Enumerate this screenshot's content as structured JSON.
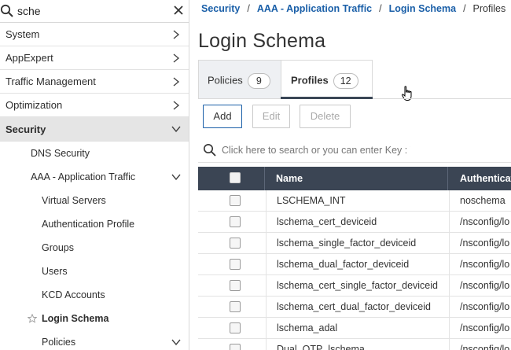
{
  "sidebar": {
    "search": {
      "value": "sche"
    },
    "items": [
      {
        "label": "System"
      },
      {
        "label": "AppExpert"
      },
      {
        "label": "Traffic Management"
      },
      {
        "label": "Optimization"
      },
      {
        "label": "Security"
      }
    ],
    "security_children": [
      {
        "label": "DNS Security"
      },
      {
        "label": "AAA - Application Traffic"
      }
    ],
    "aaa_children": [
      {
        "label": "Virtual Servers"
      },
      {
        "label": "Authentication Profile"
      },
      {
        "label": "Groups"
      },
      {
        "label": "Users"
      },
      {
        "label": "KCD Accounts"
      },
      {
        "label": "Login Schema"
      },
      {
        "label": "Policies"
      }
    ]
  },
  "breadcrumb": {
    "items": [
      "Security",
      "AAA - Application Traffic",
      "Login Schema"
    ],
    "separator": "/",
    "current": "Profiles"
  },
  "page": {
    "title": "Login Schema"
  },
  "tabs": [
    {
      "label": "Policies",
      "count": "9"
    },
    {
      "label": "Profiles",
      "count": "12"
    }
  ],
  "toolbar": {
    "add": "Add",
    "edit": "Edit",
    "delete": "Delete"
  },
  "table": {
    "search_placeholder": "Click here to search or you can enter Key : Value format",
    "columns": [
      "Name",
      "Authenticati"
    ],
    "rows": [
      {
        "name": "LSCHEMA_INT",
        "auth": "noschema"
      },
      {
        "name": "lschema_cert_deviceid",
        "auth": "/nsconfig/lo"
      },
      {
        "name": "lschema_single_factor_deviceid",
        "auth": "/nsconfig/lo"
      },
      {
        "name": "lschema_dual_factor_deviceid",
        "auth": "/nsconfig/lo"
      },
      {
        "name": "lschema_cert_single_factor_deviceid",
        "auth": "/nsconfig/lo"
      },
      {
        "name": "lschema_cert_dual_factor_deviceid",
        "auth": "/nsconfig/lo"
      },
      {
        "name": "lschema_adal",
        "auth": "/nsconfig/lo"
      },
      {
        "name": "Dual_OTP_lschema",
        "auth": "/nsconfig/lo"
      }
    ]
  },
  "colors": {
    "link": "#1a5fa8",
    "header_bg": "#3b4554",
    "active_nav_bg": "#e5e5e5"
  }
}
